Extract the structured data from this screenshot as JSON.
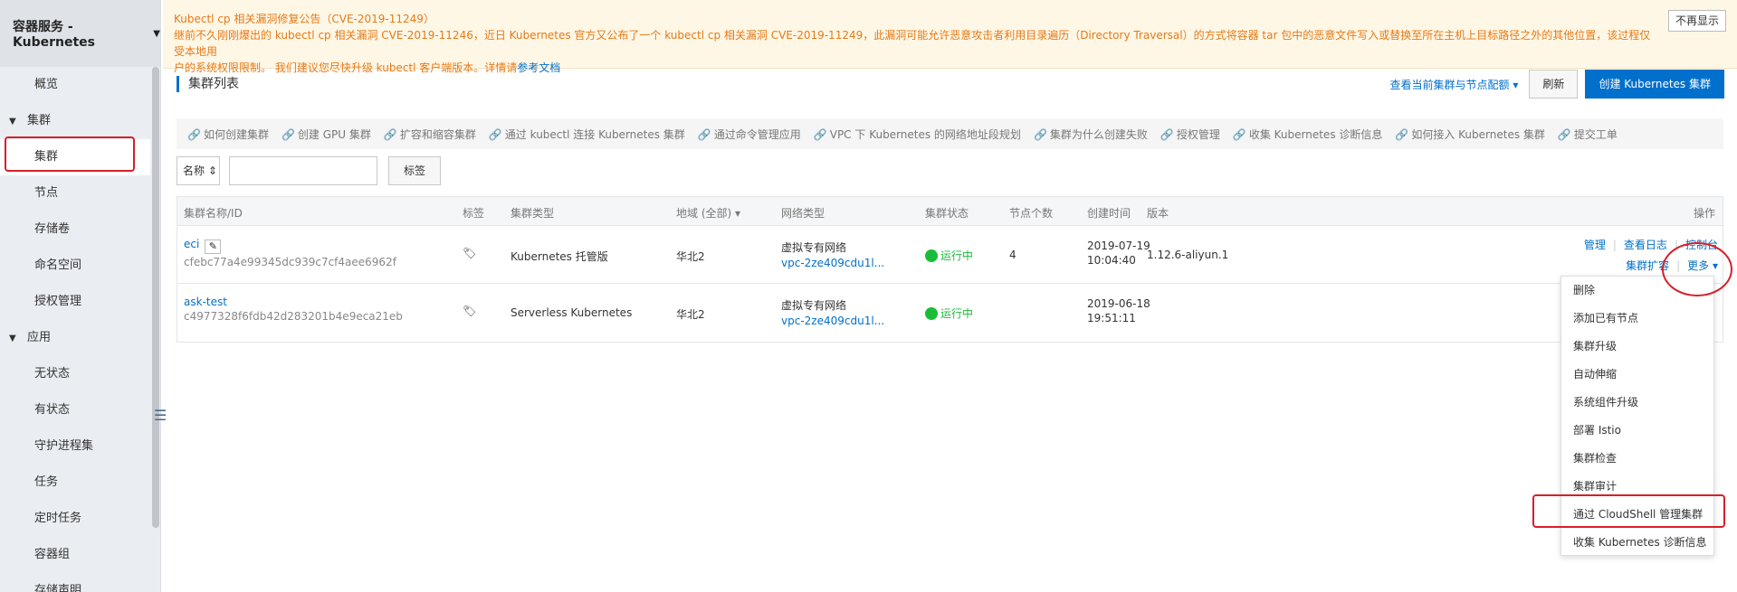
{
  "sidebar": {
    "title": "容器服务 - Kubernetes",
    "items": [
      {
        "label": "概览"
      },
      {
        "label": "集群"
      },
      {
        "label": "集群"
      },
      {
        "label": "节点"
      },
      {
        "label": "存储卷"
      },
      {
        "label": "命名空间"
      },
      {
        "label": "授权管理"
      },
      {
        "label": "应用"
      },
      {
        "label": "无状态"
      },
      {
        "label": "有状态"
      },
      {
        "label": "守护进程集"
      },
      {
        "label": "任务"
      },
      {
        "label": "定时任务"
      },
      {
        "label": "容器组"
      },
      {
        "label": "存储声明"
      }
    ]
  },
  "notice": {
    "line1": "Kubectl cp 相关漏洞修复公告（CVE-2019-11249）",
    "line2": "继前不久刚刚爆出的 kubectl cp 相关漏洞 CVE-2019-11246，近日 Kubernetes 官方又公布了一个 kubectl cp 相关漏洞 CVE-2019-11249，此漏洞可能允许恶意攻击者利用目录遍历（Directory Traversal）的方式将容器 tar 包中的恶意文件写入或替换至所在主机上目标路径之外的其他位置，该过程仅受本地用",
    "line3": "户的系统权限限制。 我们建议您尽快升级 kubectl 客户端版本。详情请",
    "link": "参考文档",
    "dismiss": "不再显示"
  },
  "page": {
    "title": "集群列表",
    "config_link": "查看当前集群与节点配额",
    "refresh": "刷新",
    "create": "创建 Kubernetes 集群"
  },
  "help_links": [
    "如何创建集群",
    "创建 GPU 集群",
    "扩容和缩容集群",
    "通过 kubectl 连接 Kubernetes 集群",
    "通过命令管理应用",
    "VPC 下 Kubernetes 的网络地址段规划",
    "集群为什么创建失败",
    "授权管理",
    "收集 Kubernetes 诊断信息",
    "如何接入 Kubernetes 集群",
    "提交工单"
  ],
  "filter": {
    "select": "名称",
    "tag_button": "标签"
  },
  "table": {
    "headers": {
      "name": "集群名称/ID",
      "tags": "标签",
      "type": "集群类型",
      "region": "地域 (全部)",
      "network": "网络类型",
      "status": "集群状态",
      "nodes": "节点个数",
      "created": "创建时间",
      "version": "版本",
      "actions": "操作"
    },
    "rows": [
      {
        "name": "eci",
        "id": "cfebc77a4e99345dc939c7cf4aee6962f",
        "type": "Kubernetes 托管版",
        "region": "华北2",
        "network": "虚拟专有网络",
        "vpc": "vpc-2ze409cdu1l...",
        "status": "运行中",
        "nodes": "4",
        "created_date": "2019-07-19",
        "created_time": "10:04:40",
        "version": "1.12.6-aliyun.1",
        "act_manage": "管理",
        "act_logs": "查看日志",
        "act_console": "控制台",
        "act_scale": "集群扩容",
        "act_more": "更多"
      },
      {
        "name": "ask-test",
        "id": "c4977328f6fdb42d283201b4e9eca21eb",
        "type": "Serverless Kubernetes",
        "region": "华北2",
        "network": "虚拟专有网络",
        "vpc": "vpc-2ze409cdu1l...",
        "status": "运行中",
        "created_date": "2019-06-18",
        "created_time": "19:51:11"
      }
    ]
  },
  "more_menu": [
    "删除",
    "添加已有节点",
    "集群升级",
    "自动伸缩",
    "系统组件升级",
    "部署 Istio",
    "集群检查",
    "集群审计",
    "通过 CloudShell 管理集群",
    "收集 Kubernetes 诊断信息"
  ],
  "colors": {
    "accent": "#0070cc",
    "running": "#1bbc3a",
    "warning": "#e57a18",
    "annotation": "#d61f2a"
  }
}
